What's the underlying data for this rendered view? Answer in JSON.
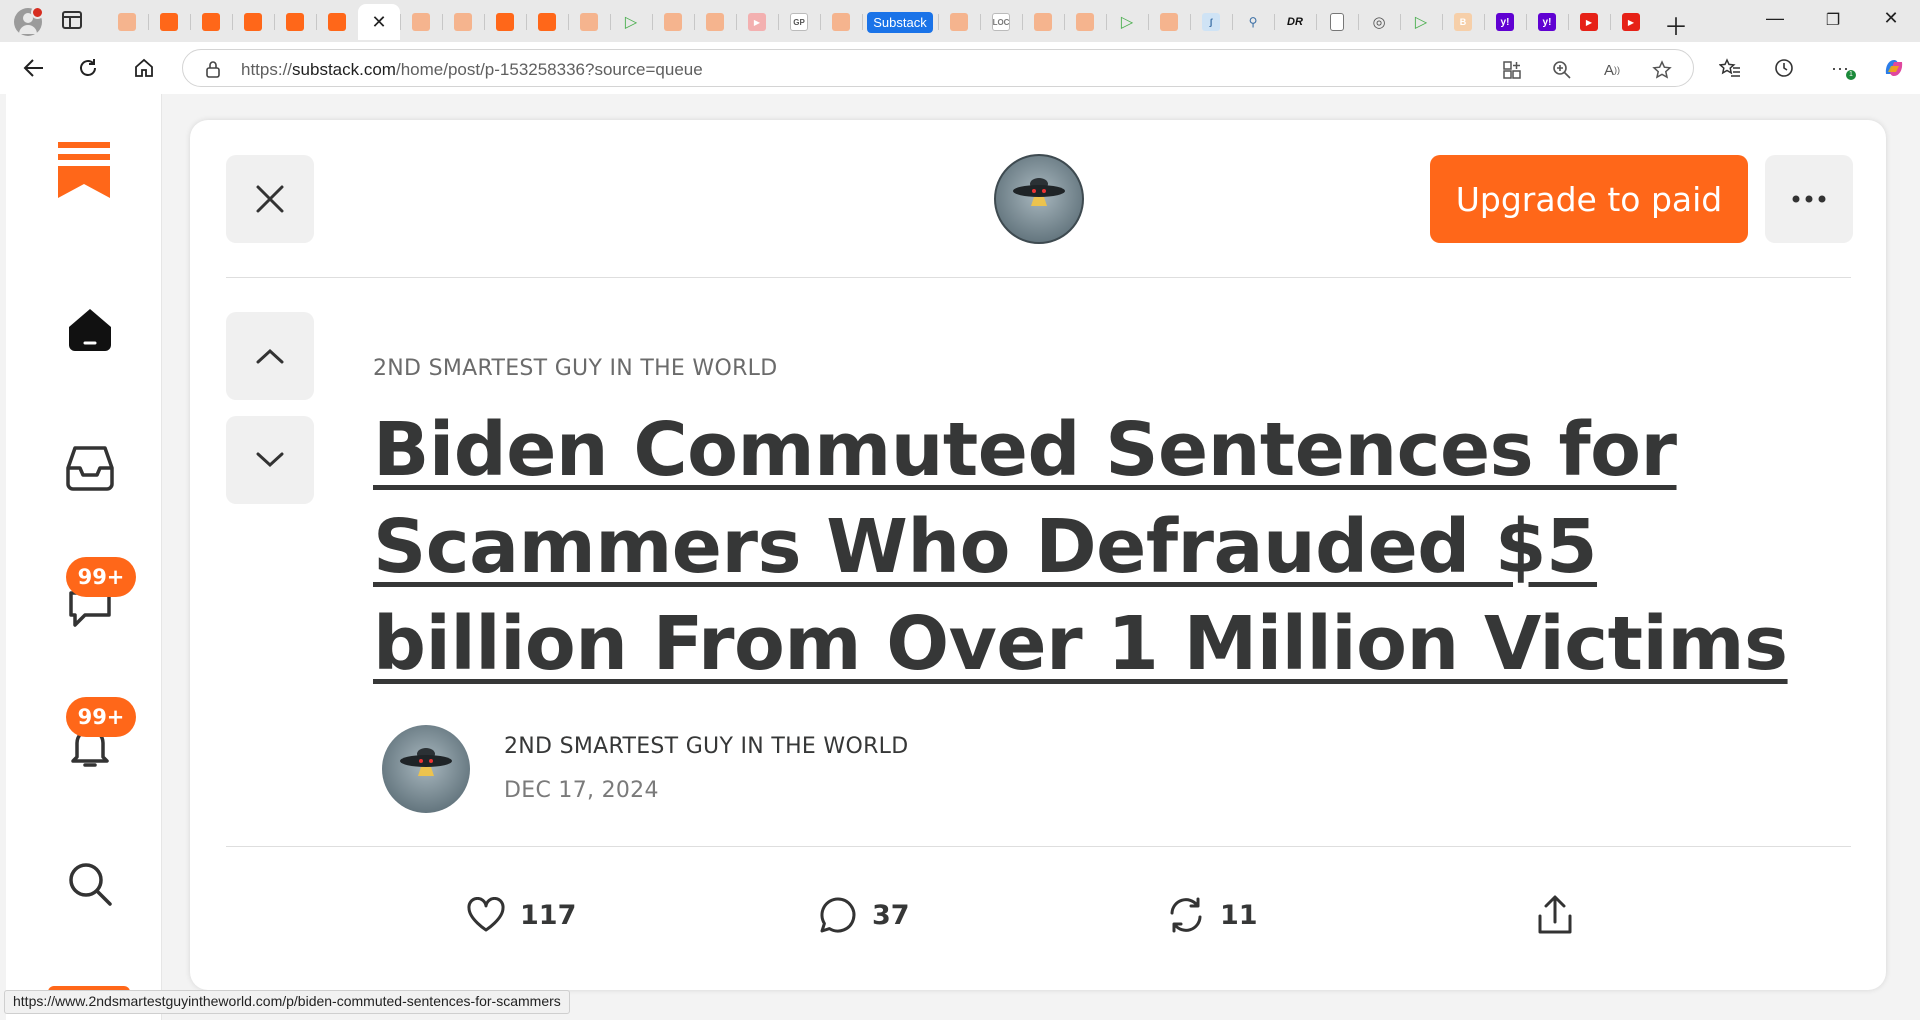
{
  "browser": {
    "address": {
      "url_prefix": "https://",
      "url_domain": "substack.com",
      "url_path": "/home/post/p-153258336?source=queue"
    },
    "tabs": [
      {
        "icon": "substack-faded-icon",
        "style": "sub-faded",
        "text": ""
      },
      {
        "icon": "substack-icon",
        "style": "sub",
        "text": ""
      },
      {
        "icon": "substack-icon",
        "style": "sub",
        "text": ""
      },
      {
        "icon": "substack-icon",
        "style": "sub",
        "text": ""
      },
      {
        "icon": "substack-icon",
        "style": "sub",
        "text": ""
      },
      {
        "icon": "substack-icon",
        "style": "sub",
        "text": ""
      },
      {
        "icon": "active-tab-close-icon",
        "style": "active",
        "text": "✕"
      },
      {
        "icon": "substack-faded-icon",
        "style": "sub-faded",
        "text": ""
      },
      {
        "icon": "substack-faded-icon",
        "style": "sub-faded",
        "text": ""
      },
      {
        "icon": "substack-icon",
        "style": "sub",
        "text": ""
      },
      {
        "icon": "substack-icon",
        "style": "sub",
        "text": ""
      },
      {
        "icon": "substack-faded-icon",
        "style": "sub-faded",
        "text": ""
      },
      {
        "icon": "play-icon",
        "style": "play",
        "text": "▷"
      },
      {
        "icon": "substack-faded-icon",
        "style": "sub-faded",
        "text": ""
      },
      {
        "icon": "substack-faded-icon",
        "style": "sub-faded",
        "text": ""
      },
      {
        "icon": "youtube-faded-icon",
        "style": "yt",
        "text": "▶"
      },
      {
        "icon": "gp-icon",
        "style": "gp",
        "text": "GP"
      },
      {
        "icon": "substack-faded-icon",
        "style": "sub-faded",
        "text": ""
      },
      {
        "icon": "substack-titled-tab",
        "style": "titled",
        "text": "Substack"
      },
      {
        "icon": "substack-faded-icon",
        "style": "sub-faded",
        "text": ""
      },
      {
        "icon": "loc-icon",
        "style": "loc",
        "text": "LOC"
      },
      {
        "icon": "substack-faded-icon",
        "style": "sub-faded",
        "text": ""
      },
      {
        "icon": "substack-faded-icon",
        "style": "sub-faded",
        "text": ""
      },
      {
        "icon": "play-icon",
        "style": "play",
        "text": "▷"
      },
      {
        "icon": "substack-faded-icon",
        "style": "sub-faded",
        "text": ""
      },
      {
        "icon": "blue-site-icon",
        "style": "blue",
        "text": "ʃ"
      },
      {
        "icon": "search-site-icon",
        "style": "search",
        "text": "⚲"
      },
      {
        "icon": "dr-icon",
        "style": "dr",
        "text": "DR"
      },
      {
        "icon": "document-icon",
        "style": "doc",
        "text": ""
      },
      {
        "icon": "robot-icon",
        "style": "rob",
        "text": "◎"
      },
      {
        "icon": "play-icon",
        "style": "play",
        "text": "▷"
      },
      {
        "icon": "b-faded-icon",
        "style": "bfade",
        "text": "B"
      },
      {
        "icon": "yahoo-icon",
        "style": "yahoo",
        "text": "y!"
      },
      {
        "icon": "yahoo-icon",
        "style": "yahoo",
        "text": "y!"
      },
      {
        "icon": "youtube-icon",
        "style": "yt-red",
        "text": "▶"
      },
      {
        "icon": "youtube-icon",
        "style": "yt-red",
        "text": "▶"
      }
    ],
    "status_url": "https://www.2ndsmartestguyintheworld.com/p/biden-commuted-sentences-for-scammers"
  },
  "sidebar": {
    "logo": "substack-logo-icon",
    "items": [
      {
        "name": "home",
        "icon": "home-icon"
      },
      {
        "name": "inbox",
        "icon": "inbox-icon"
      },
      {
        "name": "chat",
        "icon": "chat-icon",
        "badge": "99+"
      },
      {
        "name": "activity",
        "icon": "bell-icon",
        "badge": "99+"
      },
      {
        "name": "search",
        "icon": "search-icon"
      }
    ]
  },
  "post": {
    "upgrade_label": "Upgrade to paid",
    "publication": "2ND SMARTEST GUY IN THE WORLD",
    "title": "Biden Commuted Sentences for Scammers Who Defrauded $5 billion From Over 1 Million Victims",
    "author": "2ND SMARTEST GUY IN THE WORLD",
    "date": "DEC 17, 2024",
    "likes": "117",
    "comments": "37",
    "restacks": "11"
  },
  "colors": {
    "accent": "#ff6719",
    "text": "#363737",
    "muted": "#6b6b6b"
  }
}
